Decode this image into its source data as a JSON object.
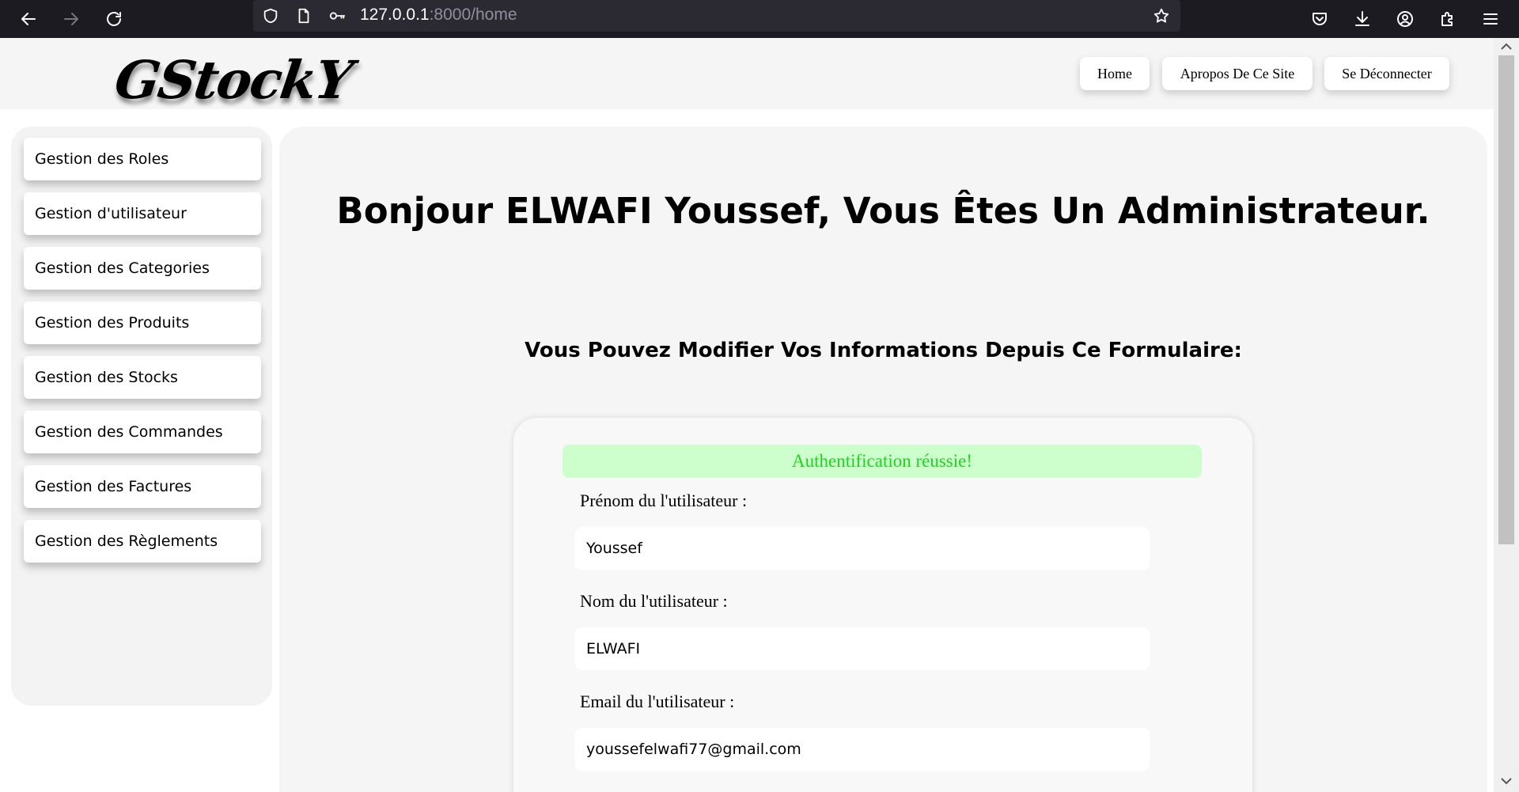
{
  "browser": {
    "url_host": "127.0.0.1",
    "url_path": ":8000/home",
    "icons": [
      "back-arrow-icon",
      "forward-arrow-icon",
      "reload-icon",
      "shield-icon",
      "page-icon",
      "key-icon",
      "star-icon",
      "pocket-icon",
      "download-icon",
      "account-icon",
      "extensions-icon",
      "menu-icon"
    ]
  },
  "header": {
    "logo": "GStockY",
    "nav": [
      "Home",
      "Apropos De Ce Site",
      "Se Déconnecter"
    ]
  },
  "sidebar": {
    "items": [
      {
        "label": "Gestion des Roles"
      },
      {
        "label": "Gestion d'utilisateur"
      },
      {
        "label": "Gestion des Categories"
      },
      {
        "label": "Gestion des Produits"
      },
      {
        "label": "Gestion des Stocks"
      },
      {
        "label": "Gestion des Commandes"
      },
      {
        "label": "Gestion des Factures"
      },
      {
        "label": "Gestion des Règlements"
      }
    ]
  },
  "main": {
    "title": "Bonjour ELWAFI Youssef, Vous Êtes Un Administrateur.",
    "subtitle": "Vous Pouvez Modifier Vos Informations Depuis Ce Formulaire:",
    "alert": "Authentification réussie!",
    "fields": [
      {
        "label": "Prénom du l'utilisateur :",
        "value": "Youssef"
      },
      {
        "label": "Nom du l'utilisateur :",
        "value": "ELWAFI"
      },
      {
        "label": "Email du l'utilisateur :",
        "value": "youssefelwafi77@gmail.com"
      }
    ]
  },
  "colors": {
    "browser_bar": "#1c1b22",
    "url_bar": "#2b2a33",
    "alert_bg": "#ccffcc",
    "alert_text": "#1fd41f",
    "panel_bg": "#f5f5f5"
  }
}
